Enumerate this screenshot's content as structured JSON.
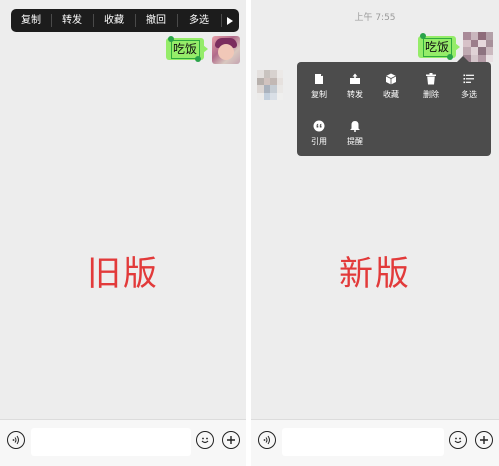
{
  "left_panel": {
    "context_menu": {
      "items": [
        "复制",
        "转发",
        "收藏",
        "撤回",
        "多选"
      ],
      "more_icon": "triangle-right-icon"
    },
    "message": {
      "text": "吃饭"
    },
    "version_label": "旧版"
  },
  "right_panel": {
    "timestamp": "上午 7:55",
    "message": {
      "text": "吃饭"
    },
    "context_menu": {
      "items": [
        {
          "label": "复制",
          "icon": "copy-icon"
        },
        {
          "label": "转发",
          "icon": "forward-icon"
        },
        {
          "label": "收藏",
          "icon": "favorite-icon"
        },
        {
          "label": "删除",
          "icon": "delete-icon"
        },
        {
          "label": "多选",
          "icon": "multiselect-icon"
        },
        {
          "label": "引用",
          "icon": "quote-icon"
        },
        {
          "label": "提醒",
          "icon": "remind-icon"
        }
      ]
    },
    "version_label": "新版"
  },
  "input_bar": {
    "voice_icon": "voice-icon",
    "emoji_icon": "emoji-icon",
    "plus_icon": "plus-icon"
  },
  "colors": {
    "bubble": "#95ec69",
    "label_red": "#e23a3a",
    "menu_old": "#1c1c1c",
    "menu_new": "#4c4c4c"
  }
}
